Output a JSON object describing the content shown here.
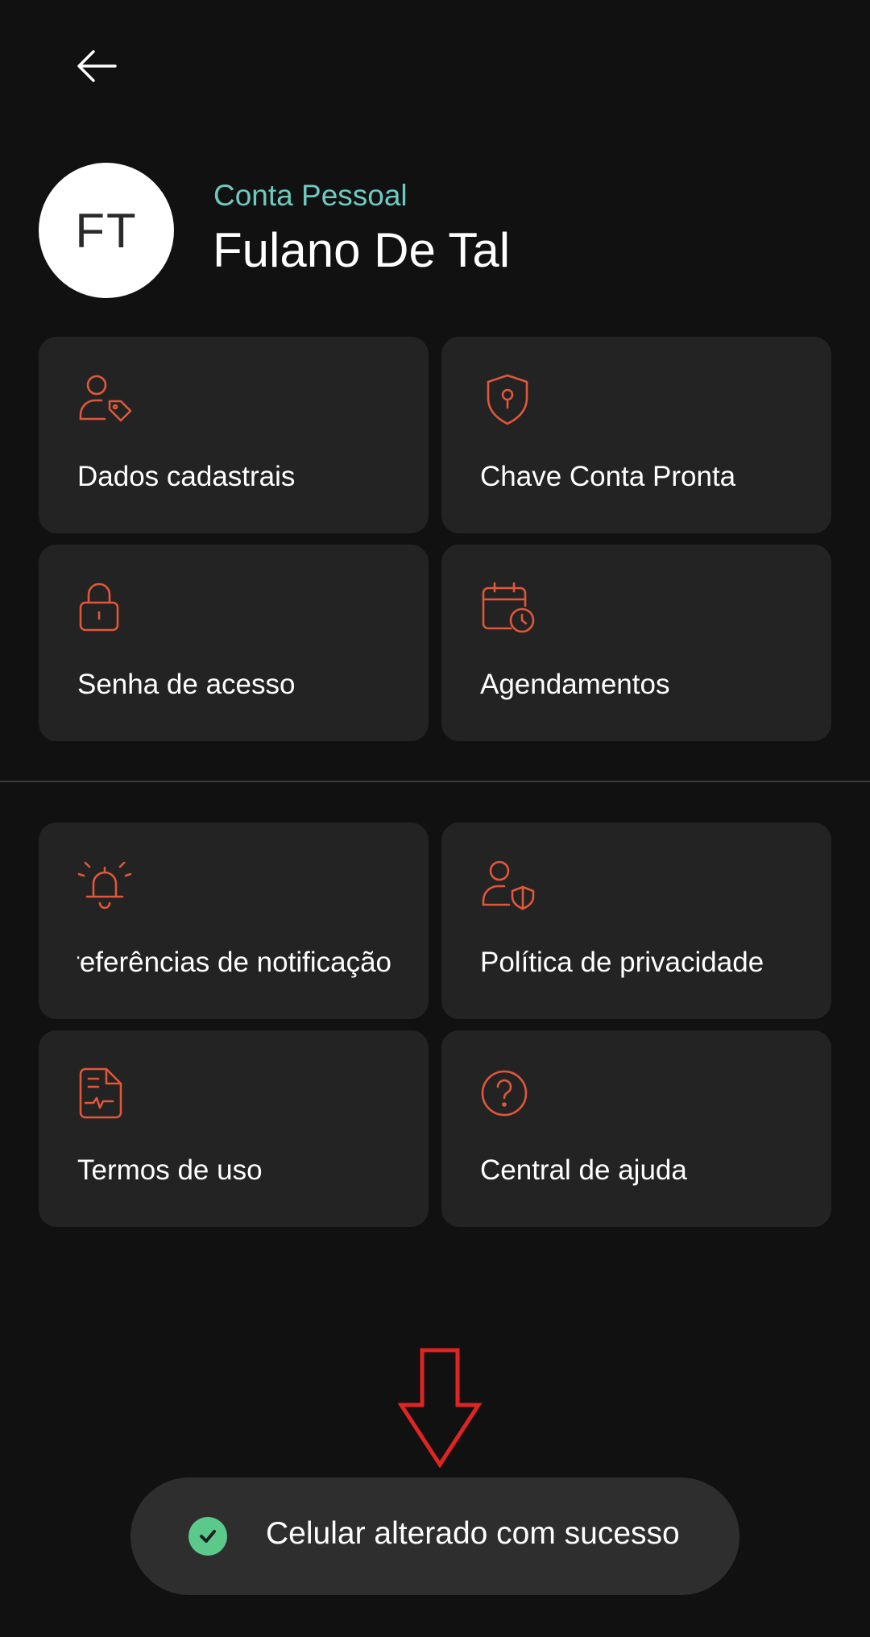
{
  "header": {
    "back_icon": "arrow-left-icon"
  },
  "profile": {
    "initials": "FT",
    "account_type": "Conta Pessoal",
    "name": "Fulano De Tal"
  },
  "menu_primary": [
    {
      "label": "Dados cadastrais",
      "icon": "user-tag-icon"
    },
    {
      "label": "Chave Conta Pronta",
      "icon": "shield-key-icon"
    },
    {
      "label": "Senha de acesso",
      "icon": "lock-icon"
    },
    {
      "label": "Agendamentos",
      "icon": "calendar-clock-icon"
    }
  ],
  "menu_secondary": [
    {
      "label": "Preferências de notificação",
      "icon": "bell-ringing-icon"
    },
    {
      "label": "Política de privacidade",
      "icon": "user-shield-icon"
    },
    {
      "label": "Termos de uso",
      "icon": "document-icon"
    },
    {
      "label": "Central de ajuda",
      "icon": "help-circle-icon"
    }
  ],
  "toast": {
    "message": "Celular alterado com sucesso",
    "icon": "check-circle-icon"
  },
  "colors": {
    "background": "#111111",
    "card": "#232323",
    "accent_icon": "#e0573a",
    "account_type": "#6fc9c0",
    "toast_bg": "#2e2e2e",
    "success": "#5bc98a",
    "annotation": "#e02424"
  }
}
